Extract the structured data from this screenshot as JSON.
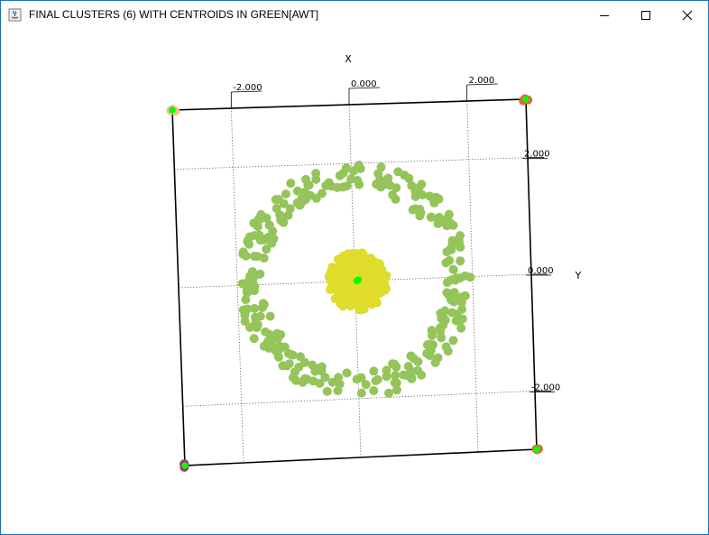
{
  "window": {
    "title": "FINAL CLUSTERS (6) WITH CENTROIDS IN GREEN[AWT]",
    "icon": "java-cup-icon",
    "controls": {
      "minimize_icon": "minimize-icon",
      "maximize_icon": "maximize-icon",
      "close_icon": "close-icon"
    }
  },
  "chart_data": {
    "type": "scatter",
    "projection": "rotated-3d-box",
    "axis_labels": {
      "x": "X",
      "y": "Y"
    },
    "x_ticks": [
      "-2.000",
      "0.000",
      "2.000"
    ],
    "y_ticks": [
      "2.000",
      "0.000",
      "-2.000"
    ],
    "x_range": [
      -3,
      3
    ],
    "y_range": [
      -3,
      3
    ],
    "grid": true,
    "centroid_color": "#00ff00",
    "clusters": [
      {
        "id": "outer-ring",
        "color": "#94c45a",
        "shape": "ring",
        "center": [
          0,
          0
        ],
        "radius_min": 1.55,
        "radius_max": 2.0,
        "count": 280
      },
      {
        "id": "center-blob",
        "color": "#e0dc2c",
        "shape": "disk",
        "center": [
          0.05,
          0.0
        ],
        "radius": 0.5,
        "count": 220
      },
      {
        "id": "corner-top-left",
        "color": "#f4c08e",
        "shape": "corner",
        "center": [
          -3,
          3
        ],
        "count": 3
      },
      {
        "id": "corner-top-right",
        "color": "#e8633a",
        "shape": "corner",
        "center": [
          3,
          3
        ],
        "count": 3
      },
      {
        "id": "corner-bottom-left",
        "color": "#a8326e",
        "shape": "corner",
        "center": [
          -3,
          -3
        ],
        "count": 3
      },
      {
        "id": "corner-bottom-right",
        "color": "#e8633a",
        "shape": "corner",
        "center": [
          3,
          -3
        ],
        "count": 3
      }
    ],
    "centroids": [
      {
        "cluster": "outer-ring",
        "x": 0.03,
        "y": 0.0
      },
      {
        "cluster": "center-blob",
        "x": 0.06,
        "y": 0.02
      },
      {
        "cluster": "corner-top-left",
        "x": -3,
        "y": 3
      },
      {
        "cluster": "corner-top-right",
        "x": 3,
        "y": 3
      },
      {
        "cluster": "corner-bottom-left",
        "x": -3,
        "y": -3
      },
      {
        "cluster": "corner-bottom-right",
        "x": 3,
        "y": -3
      }
    ]
  }
}
